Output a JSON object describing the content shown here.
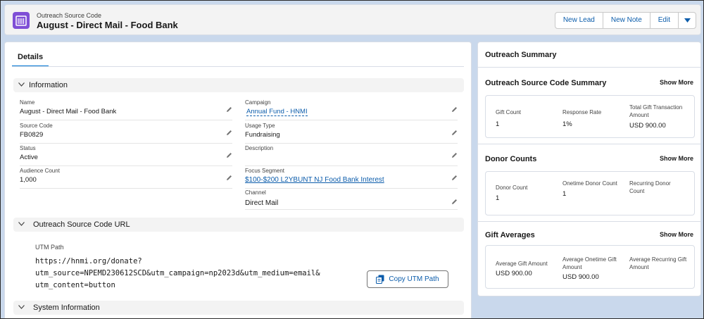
{
  "header": {
    "object_type": "Outreach Source Code",
    "title": "August - Direct Mail - Food Bank",
    "buttons": [
      "New Lead",
      "New Note",
      "Edit"
    ],
    "icon": "outreach-calendar-icon",
    "icon_color": "#7f4fd6"
  },
  "tabs": {
    "details": "Details"
  },
  "sections": {
    "information": "Information",
    "utm": "Outreach Source Code URL",
    "system": "System Information"
  },
  "fields": {
    "name": {
      "label": "Name",
      "value": "August - Direct Mail - Food Bank"
    },
    "source_code": {
      "label": "Source Code",
      "value": "FB0829"
    },
    "status": {
      "label": "Status",
      "value": "Active"
    },
    "audience_count": {
      "label": "Audience Count",
      "value": "1,000"
    },
    "campaign": {
      "label": "Campaign",
      "value": "Annual Fund - HNMI"
    },
    "usage_type": {
      "label": "Usage Type",
      "value": "Fundraising"
    },
    "description": {
      "label": "Description",
      "value": ""
    },
    "focus_segment": {
      "label": "Focus Segment",
      "value": "$100-$200 L2YBUNT NJ Food Bank Interest"
    },
    "channel": {
      "label": "Channel",
      "value": "Direct Mail"
    }
  },
  "utm": {
    "label": "UTM Path",
    "line1": "https://hnmi.org/donate?",
    "line2": "utm_source=NPEMD230612SCD&utm_campaign=np2023d&utm_medium=email&",
    "line3": "utm_content=button",
    "copy_label": "Copy UTM Path"
  },
  "summary": {
    "title": "Outreach Summary",
    "show_more": "Show More",
    "source_summary": {
      "title": "Outreach Source Code Summary",
      "metrics": [
        {
          "label": "Gift Count",
          "value": "1"
        },
        {
          "label": "Response Rate",
          "value": "1%"
        },
        {
          "label": "Total Gift Transaction Amount",
          "value": "USD 900.00"
        }
      ]
    },
    "donor_counts": {
      "title": "Donor Counts",
      "metrics": [
        {
          "label": "Donor Count",
          "value": "1"
        },
        {
          "label": "Onetime Donor Count",
          "value": "1"
        },
        {
          "label": "Recurring Donor Count",
          "value": ""
        }
      ]
    },
    "gift_averages": {
      "title": "Gift Averages",
      "metrics": [
        {
          "label": "Average Gift Amount",
          "value": "USD 900.00"
        },
        {
          "label": "Average Onetime Gift Amount",
          "value": "USD 900.00"
        },
        {
          "label": "Average Recurring Gift Amount",
          "value": ""
        }
      ]
    }
  },
  "colors": {
    "brand": "#0176d3",
    "link": "#0b5cab",
    "background": "#c9d8ec"
  }
}
